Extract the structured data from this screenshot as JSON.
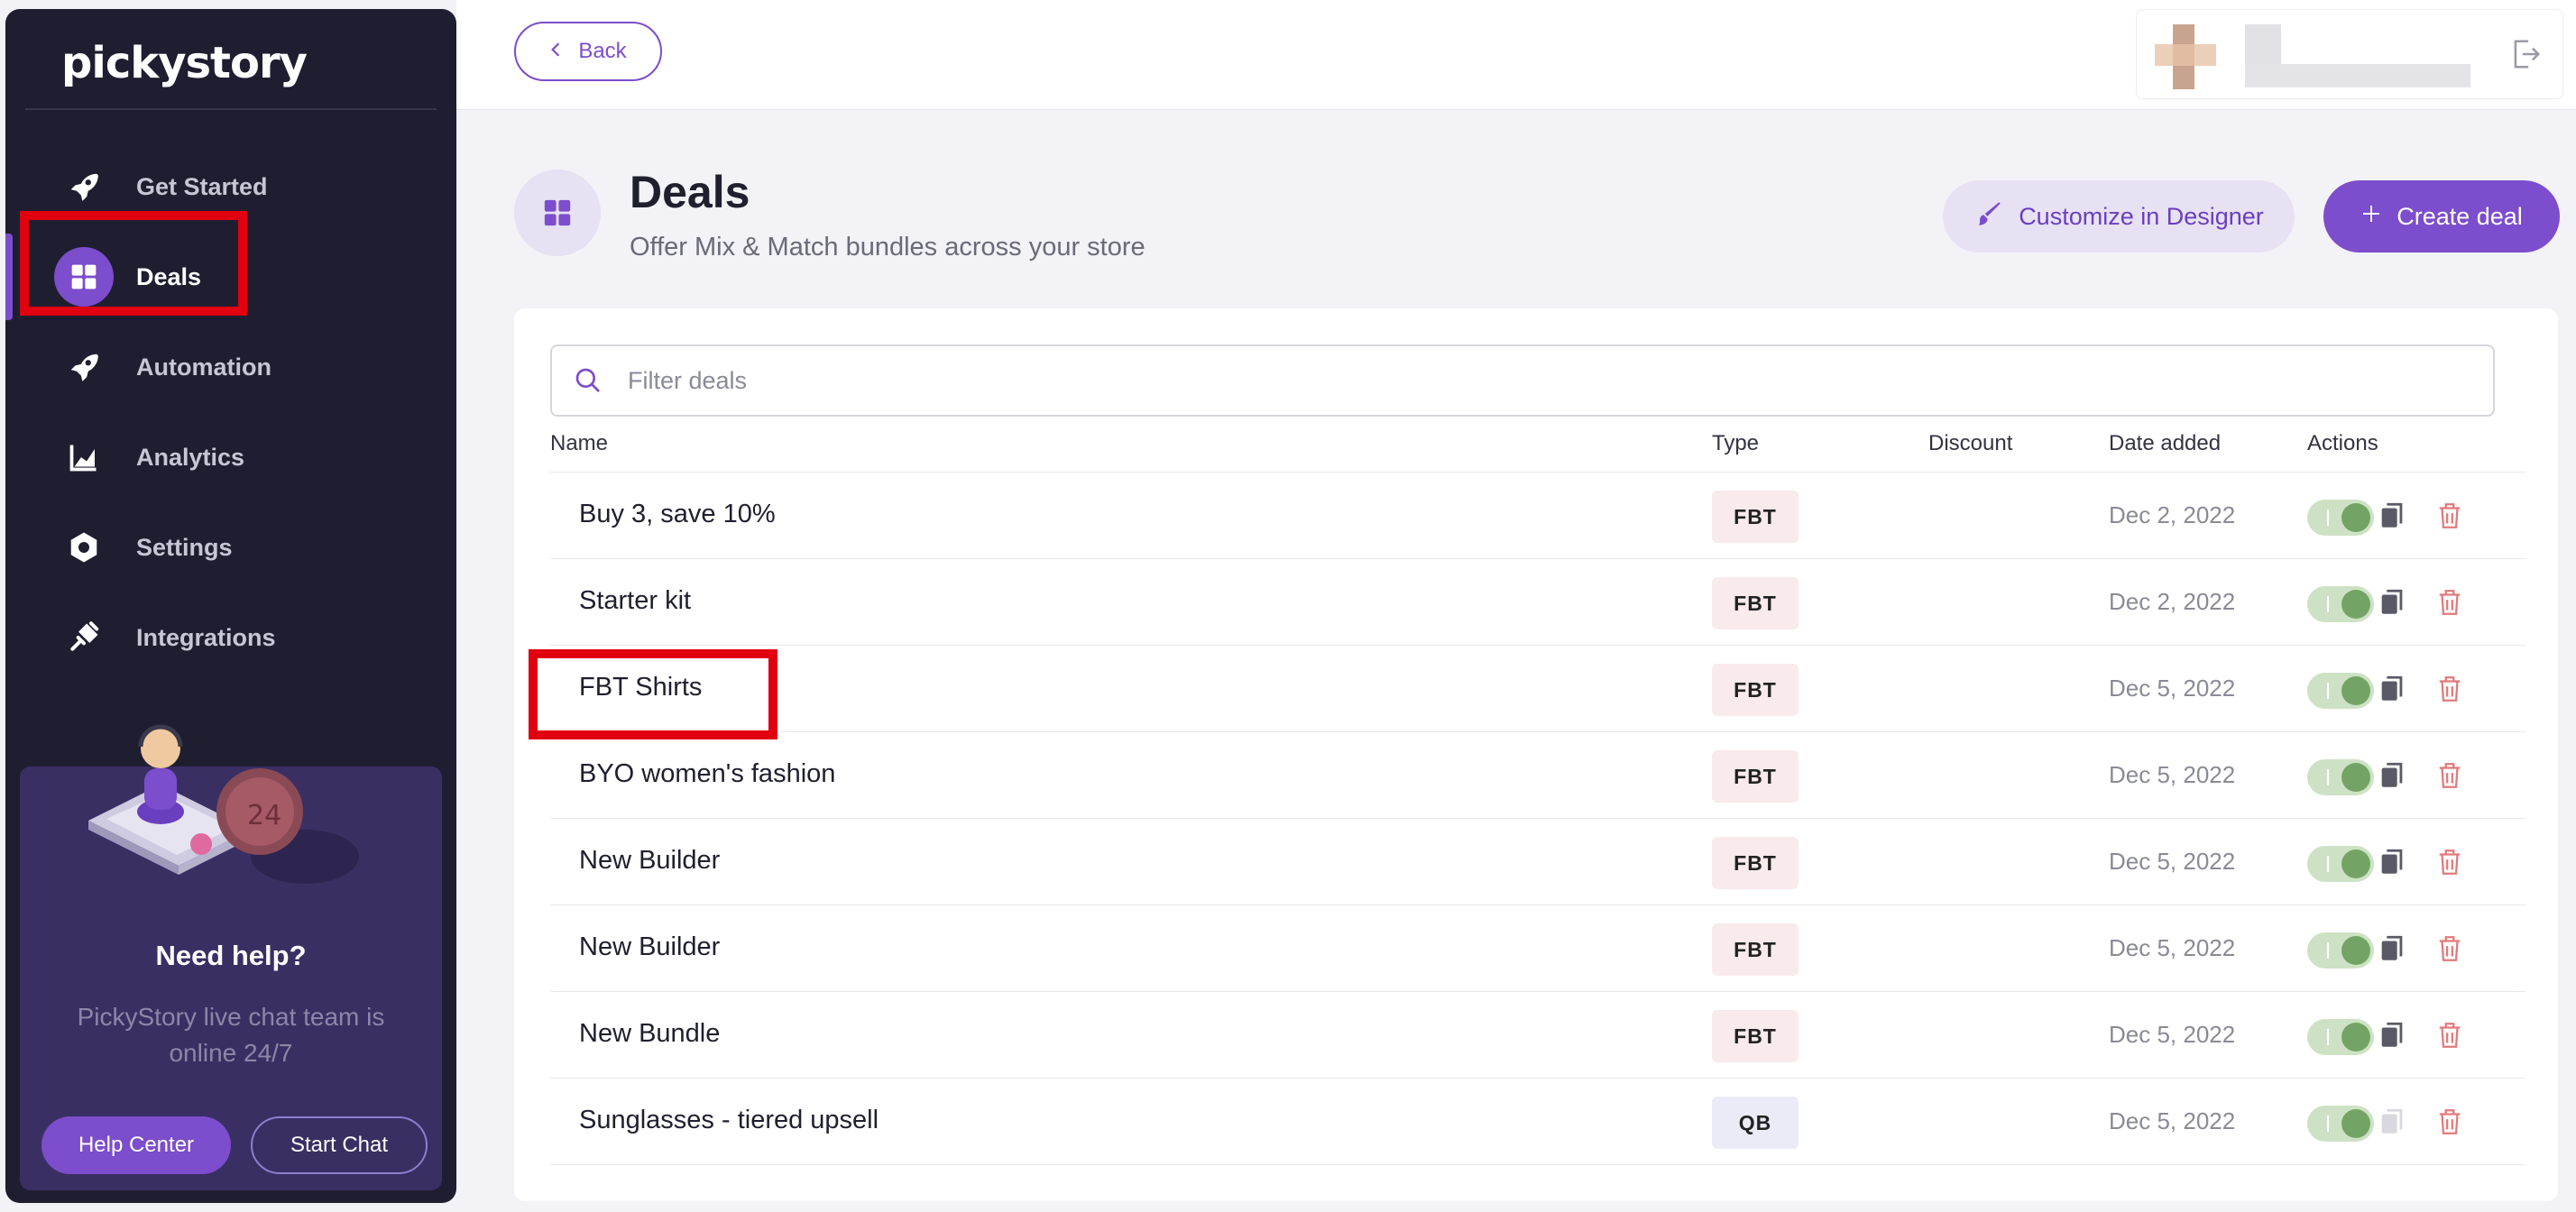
{
  "app": {
    "brand": "pickystory"
  },
  "sidebar": {
    "items": [
      {
        "label": "Get Started",
        "icon": "rocket-icon"
      },
      {
        "label": "Deals",
        "icon": "grid-icon",
        "active": true
      },
      {
        "label": "Automation",
        "icon": "rocket-icon"
      },
      {
        "label": "Analytics",
        "icon": "chart-icon"
      },
      {
        "label": "Settings",
        "icon": "gear-icon"
      },
      {
        "label": "Integrations",
        "icon": "plug-icon"
      }
    ],
    "help": {
      "title": "Need help?",
      "text": "PickyStory live chat team is online 24/7",
      "help_center": "Help Center",
      "start_chat": "Start Chat"
    }
  },
  "topbar": {
    "back_label": "Back"
  },
  "header": {
    "title": "Deals",
    "subtitle": "Offer Mix & Match bundles across your store",
    "customize_label": "Customize in Designer",
    "create_label": "Create deal"
  },
  "table": {
    "filter_placeholder": "Filter deals",
    "columns": [
      "Name",
      "Type",
      "Discount",
      "Date added",
      "Actions"
    ],
    "rows": [
      {
        "name": "Buy 3, save 10%",
        "type": "FBT",
        "discount": "",
        "date": "Dec 2, 2022",
        "enabled": true
      },
      {
        "name": "Starter kit",
        "type": "FBT",
        "discount": "",
        "date": "Dec 2, 2022",
        "enabled": true
      },
      {
        "name": "FBT Shirts",
        "type": "FBT",
        "discount": "",
        "date": "Dec 5, 2022",
        "enabled": true
      },
      {
        "name": "BYO women's fashion",
        "type": "FBT",
        "discount": "",
        "date": "Dec 5, 2022",
        "enabled": true
      },
      {
        "name": "New Builder",
        "type": "FBT",
        "discount": "",
        "date": "Dec 5, 2022",
        "enabled": true
      },
      {
        "name": "New Builder",
        "type": "FBT",
        "discount": "",
        "date": "Dec 5, 2022",
        "enabled": true
      },
      {
        "name": "New Bundle",
        "type": "FBT",
        "discount": "",
        "date": "Dec 5, 2022",
        "enabled": true
      },
      {
        "name": "Sunglasses - tiered upsell",
        "type": "QB",
        "discount": "",
        "date": "Dec 5, 2022",
        "enabled": true
      }
    ]
  },
  "colors": {
    "accent": "#7c4dcc",
    "sidebar_bg": "#1f1e30",
    "highlight": "#e0000f",
    "toggle_on": "#74a465",
    "delete": "#e07a7a"
  }
}
